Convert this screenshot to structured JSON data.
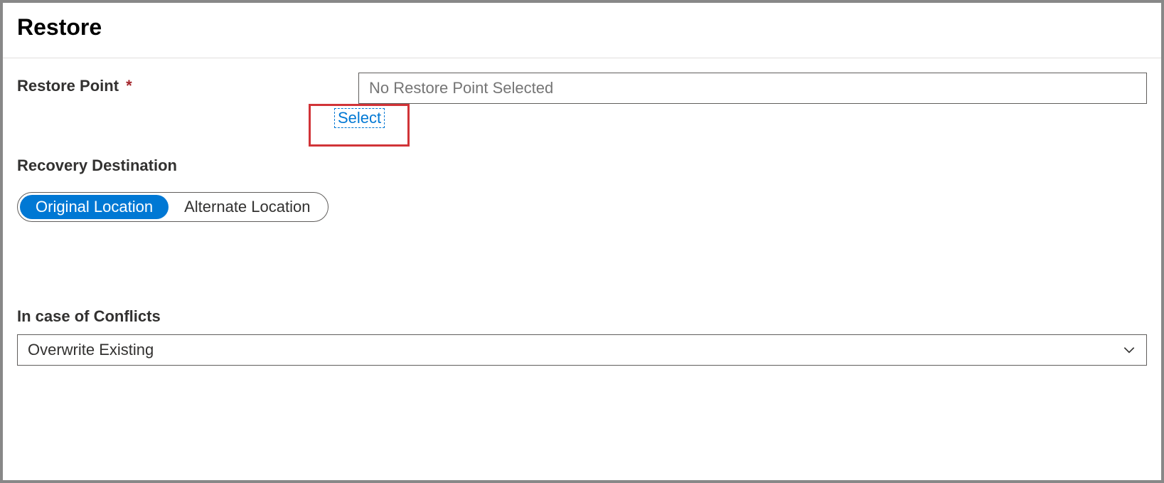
{
  "header": {
    "title": "Restore"
  },
  "restorePoint": {
    "label": "Restore Point",
    "required": "*",
    "placeholder": "No Restore Point Selected",
    "selectLink": "Select"
  },
  "recoveryDestination": {
    "label": "Recovery Destination",
    "options": {
      "original": "Original Location",
      "alternate": "Alternate Location"
    }
  },
  "conflicts": {
    "label": "In case of Conflicts",
    "selected": "Overwrite Existing"
  }
}
